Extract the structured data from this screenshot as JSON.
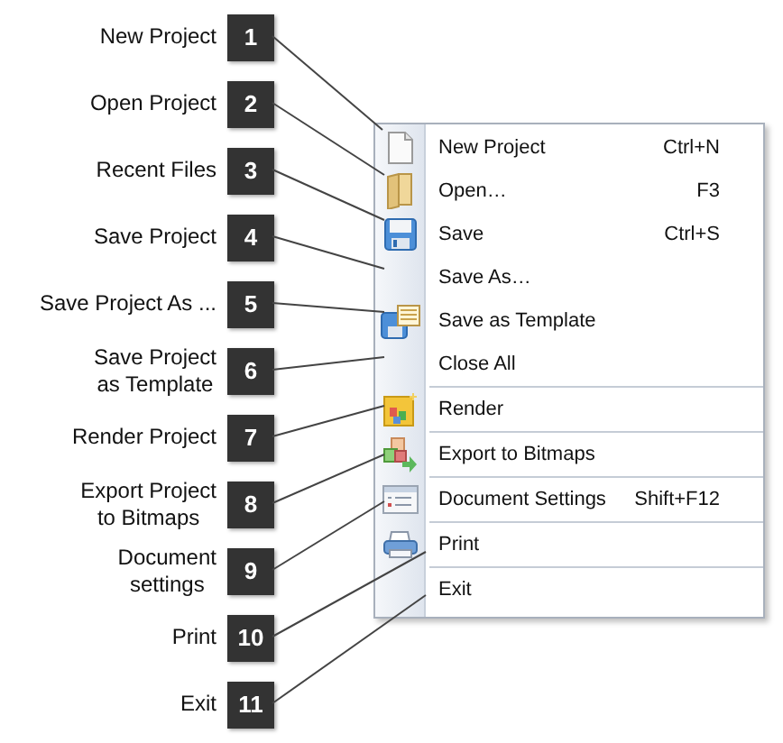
{
  "callouts": [
    {
      "number": "1",
      "lines": [
        "New Project"
      ]
    },
    {
      "number": "2",
      "lines": [
        "Open Project"
      ]
    },
    {
      "number": "3",
      "lines": [
        "Recent Files"
      ]
    },
    {
      "number": "4",
      "lines": [
        "Save Project"
      ]
    },
    {
      "number": "5",
      "lines": [
        "Save Project As ..."
      ]
    },
    {
      "number": "6",
      "lines": [
        "Save Project",
        "as Template"
      ]
    },
    {
      "number": "7",
      "lines": [
        "Render Project"
      ]
    },
    {
      "number": "8",
      "lines": [
        "Export Project",
        "to Bitmaps"
      ]
    },
    {
      "number": "9",
      "lines": [
        "Document",
        "settings"
      ]
    },
    {
      "number": "10",
      "lines": [
        "Print"
      ]
    },
    {
      "number": "11",
      "lines": [
        "Exit"
      ]
    }
  ],
  "menu": {
    "items": [
      {
        "kind": "document",
        "label": "New Project",
        "shortcut": "Ctrl+N"
      },
      {
        "kind": "folder",
        "label": "Open…",
        "shortcut": "F3"
      },
      {
        "kind": "floppy",
        "label": "Save",
        "shortcut": "Ctrl+S"
      },
      {
        "kind": "plain",
        "label": "Save As…"
      },
      {
        "kind": "floppy-list",
        "label": "Save as Template"
      },
      {
        "kind": "plain",
        "label": "Close All"
      },
      {
        "kind": "separator"
      },
      {
        "kind": "render",
        "label": "Render"
      },
      {
        "kind": "separator"
      },
      {
        "kind": "export",
        "label": "Export to Bitmaps"
      },
      {
        "kind": "separator"
      },
      {
        "kind": "settings",
        "label": "Document Settings",
        "shortcut": "Shift+F12"
      },
      {
        "kind": "separator"
      },
      {
        "kind": "printer",
        "label": "Print"
      },
      {
        "kind": "separator"
      },
      {
        "kind": "plain",
        "label": "Exit"
      }
    ]
  }
}
